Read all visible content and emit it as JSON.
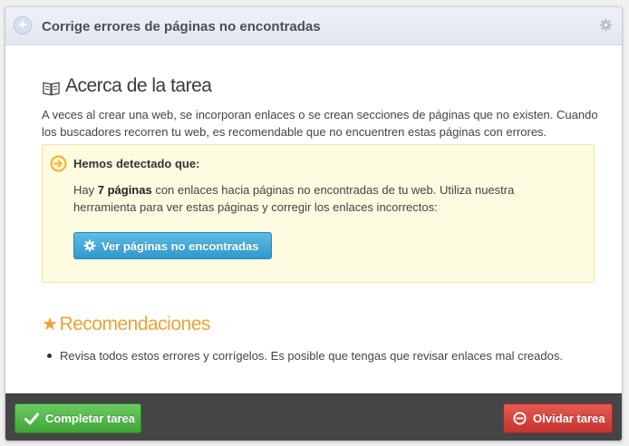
{
  "header": {
    "title": "Corrige errores de páginas no encontradas",
    "expand_icon": "plus-icon",
    "settings_icon": "gear-icon"
  },
  "about": {
    "title": "Acerca de la tarea",
    "icon": "book-icon",
    "intro": "A veces al crear una web, se incorporan enlaces o se crean secciones de páginas que no existen. Cuando los buscadores recorren tu web, es recomendable que no encuentren estas páginas con errores."
  },
  "detection": {
    "heading": "Hemos detectado que:",
    "icon": "arrow-right-circle-icon",
    "text_before": "Hay ",
    "count_text": "7 páginas",
    "text_after": " con enlaces hacia páginas no encontradas de tu web. Utiliza nuestra herramienta para ver estas páginas y corregir los enlaces incorrectos:",
    "button_label": "Ver páginas no encontradas"
  },
  "recommendations": {
    "title": "Recomendaciones",
    "icon": "star-icon",
    "items": [
      "Revisa todos estos errores y corrígelos. Es posible que tengas que revisar enlaces mal creados."
    ]
  },
  "footer": {
    "complete_label": "Completar tarea",
    "forget_label": "Olvidar tarea"
  },
  "colors": {
    "accent_blue": "#2f98cc",
    "success_green": "#3fa535",
    "danger_red": "#c3352e",
    "recommendation_orange": "#eea236",
    "alert_background": "#fdfbe0"
  }
}
